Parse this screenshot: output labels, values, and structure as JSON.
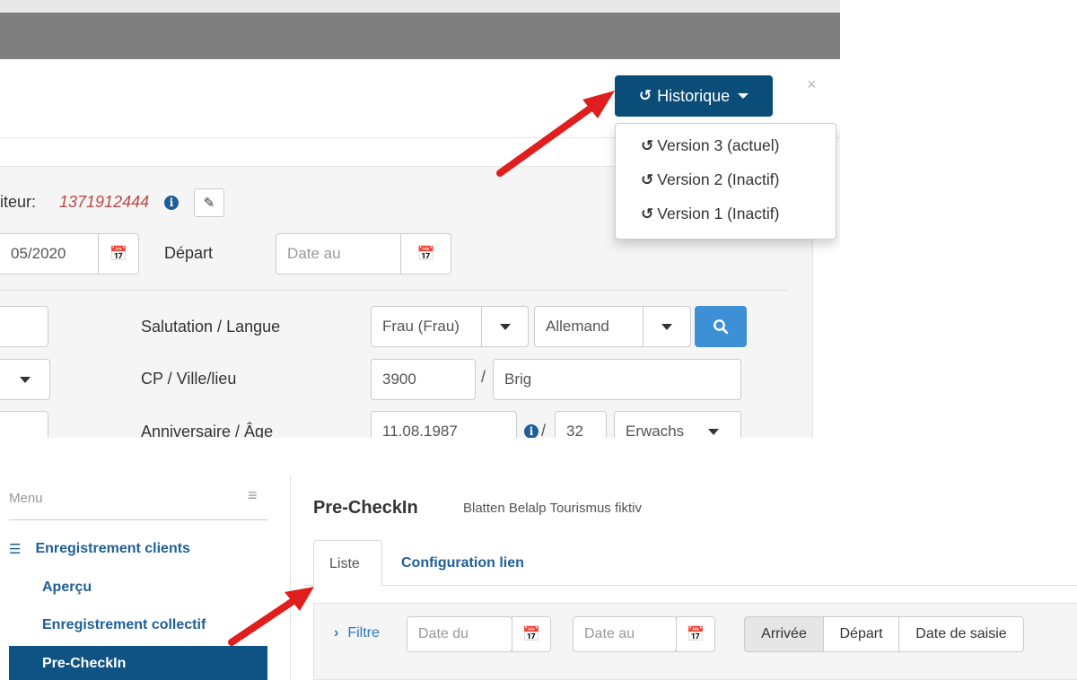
{
  "modal": {
    "history_button_label": "Historique",
    "close_label": "×",
    "versions": [
      {
        "label": "Version 3 (actuel)"
      },
      {
        "label": "Version 2 (Inactif)"
      },
      {
        "label": "Version 1 (Inactif)"
      }
    ],
    "visitor_label": "iteur:",
    "visitor_number": "1371912444",
    "arrival_date_value": "05/2020",
    "departure_label": "Départ",
    "departure_placeholder": "Date au",
    "salutation_label": "Salutation / Langue",
    "salutation_value": "Frau (Frau)",
    "language_value": "Allemand",
    "zip_city_label": "CP / Ville/lieu",
    "zip_value": "3900",
    "slash": "/",
    "city_value": "Brig",
    "birthday_label": "Anniversaire / Âge",
    "birthday_value": "11.08.1987",
    "age_value": "32",
    "category_value": "Erwachs"
  },
  "sidebar": {
    "menu_title": "Menu",
    "group_label": "Enregistrement clients",
    "items": [
      {
        "label": "Aperçu"
      },
      {
        "label": "Enregistrement collectif"
      },
      {
        "label": "Pre-CheckIn"
      }
    ]
  },
  "page": {
    "title": "Pre-CheckIn",
    "subtitle": "Blatten Belalp Tourismus fiktiv",
    "tabs": [
      {
        "label": "Liste"
      },
      {
        "label": "Configuration lien"
      }
    ],
    "filter": {
      "label": "Filtre",
      "date_from_placeholder": "Date du",
      "date_to_placeholder": "Date au",
      "segments": [
        "Arrivée",
        "Départ",
        "Date de saisie"
      ]
    }
  },
  "colors": {
    "primary_dark": "#0a4d78",
    "link_blue": "#1f5f96",
    "search_blue": "#3d8fd6",
    "arrow_red": "#e01e1e",
    "visitor_number_red": "#b94a48"
  },
  "icons": [
    "history-icon",
    "info-icon",
    "pencil-icon",
    "calendar-icon",
    "search-icon",
    "menu-toggle-icon",
    "list-icon",
    "chevron-right-icon",
    "close-icon"
  ]
}
